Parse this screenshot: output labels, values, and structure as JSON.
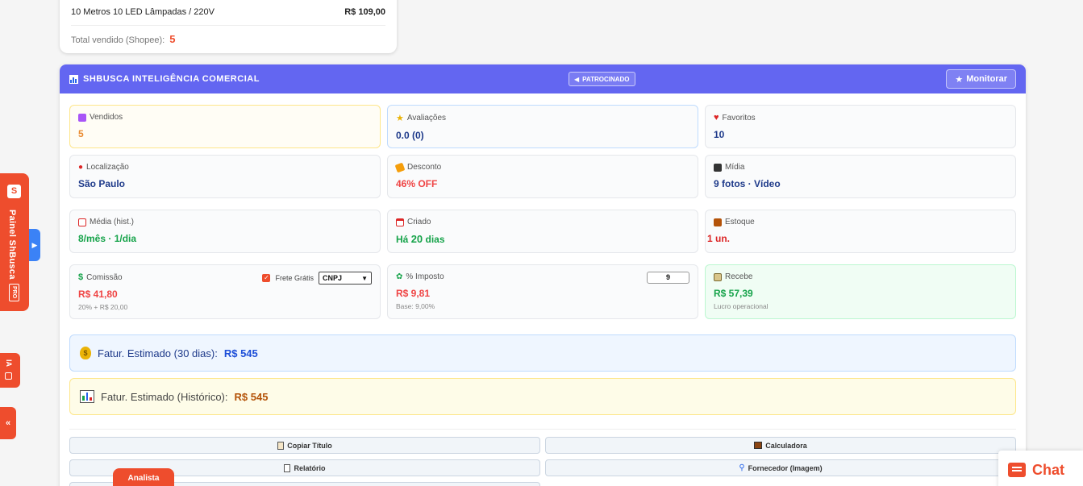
{
  "top_card": {
    "product_name": "10 Metros 10 LED Lâmpadas / 220V",
    "price": "R$ 109,00",
    "total_label": "Total vendido (Shopee):",
    "total_value": "5"
  },
  "panel": {
    "title": "SHBUSCA INTELIGÊNCIA COMERCIAL",
    "sponsored": "PATROCINADO",
    "monitor_button": "Monitorar"
  },
  "cards": {
    "vendidos": {
      "label": "Vendidos",
      "value": "5"
    },
    "avaliacoes": {
      "label": "Avaliações",
      "value": "0.0 (0)"
    },
    "favoritos": {
      "label": "Favoritos",
      "value": "10"
    },
    "localizacao": {
      "label": "Localização",
      "value": "São Paulo"
    },
    "desconto": {
      "label": "Desconto",
      "value": "46% OFF"
    },
    "midia": {
      "label": "Mídia",
      "value": "9 fotos · Vídeo"
    },
    "media": {
      "label": "Média (hist.)",
      "value": "8/mês · 1/dia"
    },
    "criado": {
      "label": "Criado",
      "value_prefix": "Há",
      "value_number": "20",
      "value_suffix": "dias"
    },
    "estoque": {
      "label": "Estoque",
      "value": "1 un."
    },
    "comissao": {
      "label": "Comissão",
      "value": "R$ 41,80",
      "sub": "20% + R$ 20,00",
      "frete_label": "Frete Grátis",
      "select_value": "CNPJ"
    },
    "imposto": {
      "label": "% Imposto",
      "value": "R$ 9,81",
      "sub": "Base: 9,00%",
      "input_value": "9"
    },
    "recebe": {
      "label": "Recebe",
      "value": "R$ 57,39",
      "sub": "Lucro operacional"
    }
  },
  "estimates": {
    "thirty_days_label": "Fatur. Estimado (30 dias):",
    "thirty_days_value": "R$ 545",
    "historic_label": "Fatur. Estimado (Histórico):",
    "historic_value": "R$ 545"
  },
  "actions": {
    "copy_title": "Copiar Título",
    "calculator": "Calculadora",
    "report": "Relatório",
    "supplier": "Fornecedor (Imagem)"
  },
  "side": {
    "panel_label": "Painel ShBusca",
    "pro": "PRO",
    "ia": "IA",
    "collapse": "«"
  },
  "analista_tab": "Analista",
  "chat": "Chat",
  "colors": {
    "shopee_orange": "#ee4d2d",
    "header_indigo": "#6366f1"
  }
}
